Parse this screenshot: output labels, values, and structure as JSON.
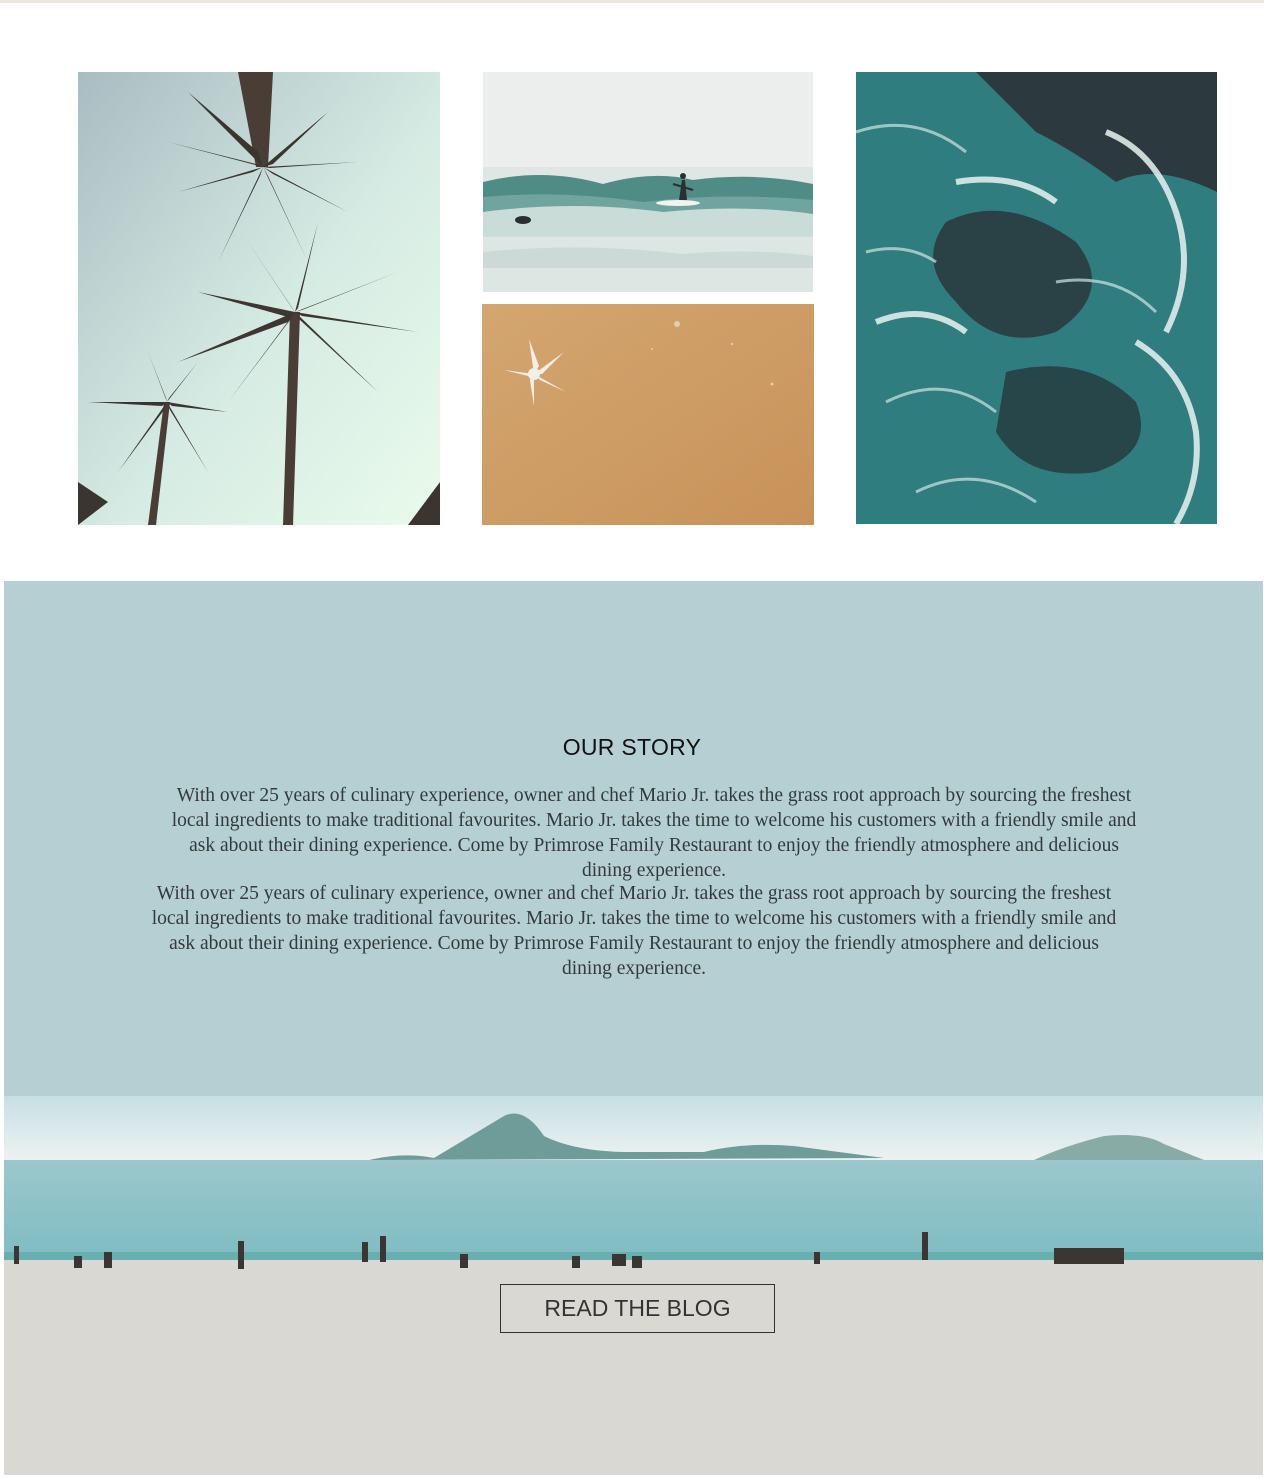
{
  "gallery": {
    "images": [
      {
        "name": "palm-trees-photo"
      },
      {
        "name": "surfer-wave-photo"
      },
      {
        "name": "starfish-sand-photo"
      },
      {
        "name": "ocean-waves-photo"
      }
    ]
  },
  "story": {
    "title": "OUR STORY",
    "paragraph_1": "With over 25 years of culinary experience, owner and chef Mario Jr. takes the grass root approach by sourcing the freshest local ingredients to make traditional favourites. Mario Jr. takes the time to welcome his customers with a friendly smile and ask about their dining experience. Come by Primrose Family Restaurant to enjoy the friendly atmosphere and delicious dining experience.",
    "paragraph_2": "With over 25 years of culinary experience, owner and chef Mario Jr. takes the grass root approach by sourcing the freshest local ingredients to make traditional favourites. Mario Jr. takes the time to welcome his customers with a friendly smile and ask about their dining experience. Come by Primrose Family Restaurant to enjoy the friendly atmosphere and delicious dining experience."
  },
  "blog": {
    "button_label": "READ THE BLOG"
  },
  "colors": {
    "story_background": "#b5cfd3",
    "button_border": "#333333",
    "sand": "#dad8d3",
    "sea": "#84bfc5"
  }
}
